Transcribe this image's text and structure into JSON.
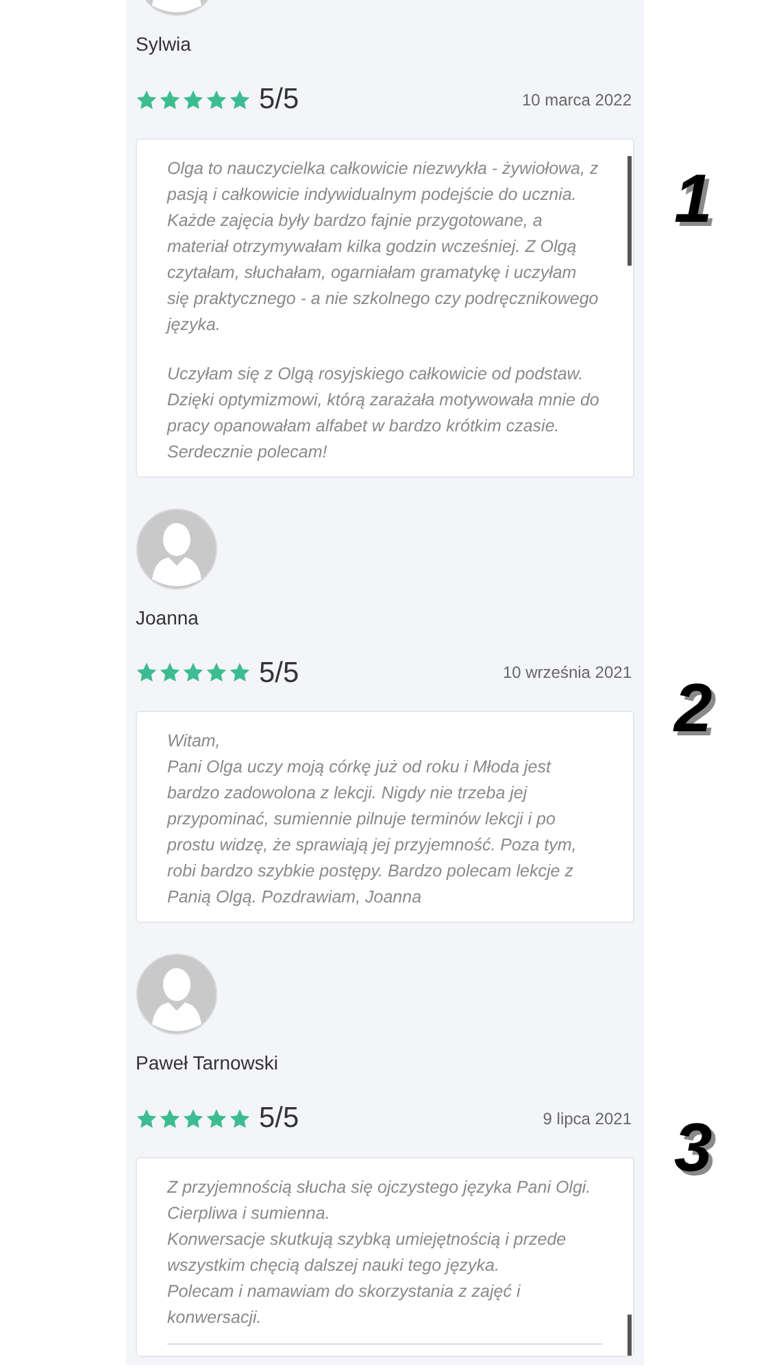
{
  "reviews": [
    {
      "number": "1",
      "name": "Sylwia",
      "stars": 5,
      "score": "5/5",
      "date": "10 marca 2022",
      "scrollable": true,
      "scrolled_to_end": false,
      "paragraphs": [
        [
          "Olga to nauczycielka całkowicie niezwykła - żywiołowa, z pasją i całkowicie indywidualnym podejście do ucznia. Każde zajęcia były bardzo fajnie przygotowane, a materiał otrzymywałam kilka godzin wcześniej. Z Olgą czytałam, słuchałam, ogarniałam gramatykę i uczyłam się praktycznego - a nie szkolnego czy podręcznikowego języka."
        ],
        [
          "Uczyłam się z Olgą rosyjskiego całkowicie od podstaw. Dzięki optymizmowi, którą zarażała motywowała mnie do pracy opanowałam alfabet w bardzo krótkim czasie. Serdecznie polecam!"
        ]
      ]
    },
    {
      "number": "2",
      "name": "Joanna",
      "stars": 5,
      "score": "5/5",
      "date": "10 września 2021",
      "scrollable": false,
      "paragraphs": [
        [
          "Witam,",
          "Pani Olga uczy moją córkę już od roku i Młoda jest bardzo zadowolona z lekcji. Nigdy nie trzeba jej przypominać, sumiennie pilnuje terminów lekcji i po prostu widzę, że sprawiają jej przyjemność. Poza tym, robi bardzo szybkie postępy. Bardzo polecam lekcje z Panią Olgą. Pozdrawiam, Joanna"
        ]
      ]
    },
    {
      "number": "3",
      "name": "Paweł Tarnowski",
      "stars": 5,
      "score": "5/5",
      "date": "9 lipca 2021",
      "scrollable": true,
      "scrolled_to_end": true,
      "paragraphs": [
        [
          "Z przyjemnością słucha się ojczystego języka Pani Olgi.",
          "Cierpliwa i sumienna.",
          "Konwersacje skutkują szybką umiejętnością i przede wszystkim chęcią dalszej nauki tego języka.",
          "Polecam i namawiam do skorzystania z zajęć i konwersacji."
        ]
      ]
    }
  ]
}
